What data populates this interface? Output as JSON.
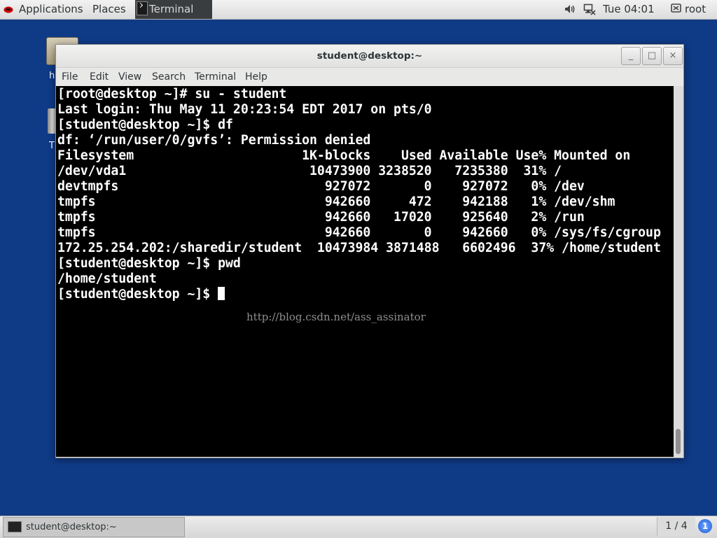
{
  "top_panel": {
    "applications": "Applications",
    "places": "Places",
    "active_app": "Terminal",
    "clock": "Tue 04:01",
    "user": "root",
    "icons": [
      "redhat-logo-icon",
      "volume-icon",
      "network-icon",
      "user-icon"
    ]
  },
  "desktop": {
    "folder_label": "h",
    "trash_label": "T"
  },
  "window": {
    "title": "student@desktop:~",
    "buttons": [
      "_",
      "□",
      "×"
    ],
    "menu": [
      "File",
      "Edit",
      "View",
      "Search",
      "Terminal",
      "Help"
    ]
  },
  "terminal": {
    "lines": [
      "[root@desktop ~]# su - student",
      "Last login: Thu May 11 20:23:54 EDT 2017 on pts/0",
      "[student@desktop ~]$ df",
      "df: ‘/run/user/0/gvfs’: Permission denied",
      "Filesystem                      1K-blocks    Used Available Use% Mounted on",
      "/dev/vda1                        10473900 3238520   7235380  31% /",
      "devtmpfs                           927072       0    927072   0% /dev",
      "tmpfs                              942660     472    942188   1% /dev/shm",
      "tmpfs                              942660   17020    925640   2% /run",
      "tmpfs                              942660       0    942660   0% /sys/fs/cgroup",
      "172.25.254.202:/sharedir/student  10473984 3871488   6602496  37% /home/student",
      "[student@desktop ~]$ pwd",
      "/home/student"
    ],
    "prompt": "[student@desktop ~]$ ",
    "watermark": "http://blog.csdn.net/ass_assinator"
  },
  "bottom_panel": {
    "task_label": "student@desktop:~",
    "workspace": "1 / 4",
    "notification": "1"
  }
}
